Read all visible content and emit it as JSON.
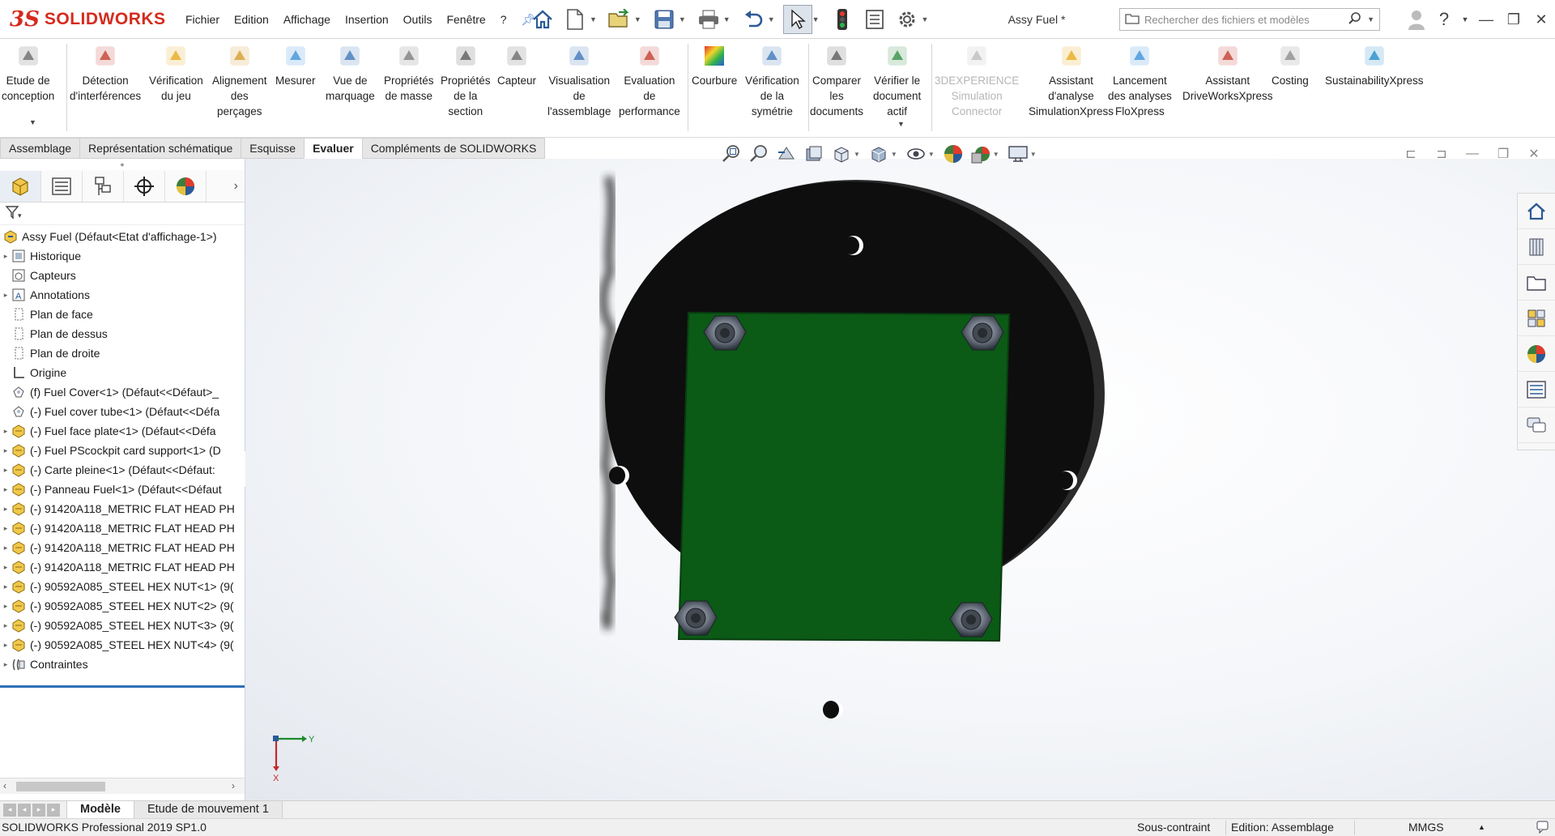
{
  "app": {
    "logo_mark": "3S",
    "logo_text": "SOLIDWORKS",
    "menus": [
      "Fichier",
      "Edition",
      "Affichage",
      "Insertion",
      "Outils",
      "Fenêtre",
      "?"
    ],
    "document_title": "Assy Fuel *",
    "search_placeholder": "Rechercher des fichiers et modèles",
    "help_label": "?"
  },
  "command_manager": {
    "commands": [
      {
        "label": "Etude de\nconception",
        "icon": "design-study-icon"
      },
      {
        "label": "Détection\nd'interférences",
        "icon": "interference-detection-icon"
      },
      {
        "label": "Vérification\ndu jeu",
        "icon": "clearance-verification-icon"
      },
      {
        "label": "Alignement\ndes\nperçages",
        "icon": "hole-alignment-icon"
      },
      {
        "label": "Mesurer",
        "icon": "measure-icon"
      },
      {
        "label": "Vue de\nmarquage",
        "icon": "markup-view-icon"
      },
      {
        "label": "Propriétés\nde masse",
        "icon": "mass-properties-icon"
      },
      {
        "label": "Propriétés\nde la\nsection",
        "icon": "section-properties-icon"
      },
      {
        "label": "Capteur",
        "icon": "sensor-icon"
      },
      {
        "label": "Visualisation\nde\nl'assemblage",
        "icon": "assembly-visualization-icon"
      },
      {
        "label": "Evaluation\nde\nperformance",
        "icon": "performance-evaluation-icon"
      },
      {
        "label": "Courbure",
        "icon": "curvature-icon"
      },
      {
        "label": "Vérification\nde la\nsymétrie",
        "icon": "symmetry-check-icon"
      },
      {
        "label": "Comparer\nles\ndocuments",
        "icon": "compare-documents-icon"
      },
      {
        "label": "Vérifier le\ndocument\nactif",
        "icon": "check-active-document-icon"
      },
      {
        "label": "3DEXPERIENCE\nSimulation\nConnector",
        "icon": "3dexperience-icon",
        "disabled": true
      },
      {
        "label": "Assistant\nd'analyse\nSimulationXpress",
        "icon": "simulationxpress-icon"
      },
      {
        "label": "Lancement\ndes analyses\nFloXpress",
        "icon": "floxpress-icon"
      },
      {
        "label": "Assistant\nDriveWorksXpress",
        "icon": "driveworksxpress-icon"
      },
      {
        "label": "Costing",
        "icon": "costing-icon"
      },
      {
        "label": "SustainabilityXpress",
        "icon": "sustainabilityxpress-icon"
      }
    ],
    "tabs": [
      {
        "label": "Assemblage",
        "active": false
      },
      {
        "label": "Représentation schématique",
        "active": false
      },
      {
        "label": "Esquisse",
        "active": false
      },
      {
        "label": "Evaluer",
        "active": true
      },
      {
        "label": "Compléments de SOLIDWORKS",
        "active": false
      }
    ]
  },
  "feature_tree": {
    "root": "Assy Fuel  (Défaut<Etat d'affichage-1>)",
    "nodes": [
      {
        "label": "Historique",
        "icon": "history-icon",
        "expandable": true
      },
      {
        "label": "Capteurs",
        "icon": "sensors-folder-icon",
        "expandable": false
      },
      {
        "label": "Annotations",
        "icon": "annotations-icon",
        "expandable": true
      },
      {
        "label": "Plan de face",
        "icon": "plane-icon",
        "expandable": false
      },
      {
        "label": "Plan de dessus",
        "icon": "plane-icon",
        "expandable": false
      },
      {
        "label": "Plan de droite",
        "icon": "plane-icon",
        "expandable": false
      },
      {
        "label": "Origine",
        "icon": "origin-icon",
        "expandable": false
      },
      {
        "label": "(f) Fuel Cover<1> (Défaut<<Défaut>_",
        "icon": "part-icon",
        "expandable": false
      },
      {
        "label": "(-) Fuel cover tube<1> (Défaut<<Défa",
        "icon": "part-icon",
        "expandable": false
      },
      {
        "label": "(-) Fuel face plate<1> (Défaut<<Défa",
        "icon": "subassembly-icon",
        "expandable": true
      },
      {
        "label": "(-) Fuel PScockpit card support<1> (D",
        "icon": "subassembly-icon",
        "expandable": true
      },
      {
        "label": "(-) Carte pleine<1> (Défaut<<Défaut:",
        "icon": "subassembly-icon",
        "expandable": true
      },
      {
        "label": "(-) Panneau Fuel<1> (Défaut<<Défaut",
        "icon": "subassembly-icon",
        "expandable": true
      },
      {
        "label": "(-) 91420A118_METRIC FLAT HEAD PH",
        "icon": "subassembly-icon",
        "expandable": true
      },
      {
        "label": "(-) 91420A118_METRIC FLAT HEAD PH",
        "icon": "subassembly-icon",
        "expandable": true
      },
      {
        "label": "(-) 91420A118_METRIC FLAT HEAD PH",
        "icon": "subassembly-icon",
        "expandable": true
      },
      {
        "label": "(-) 91420A118_METRIC FLAT HEAD PH",
        "icon": "subassembly-icon",
        "expandable": true
      },
      {
        "label": "(-) 90592A085_STEEL HEX NUT<1> (9(",
        "icon": "subassembly-icon",
        "expandable": true
      },
      {
        "label": "(-) 90592A085_STEEL HEX NUT<2> (9(",
        "icon": "subassembly-icon",
        "expandable": true
      },
      {
        "label": "(-) 90592A085_STEEL HEX NUT<3> (9(",
        "icon": "subassembly-icon",
        "expandable": true
      },
      {
        "label": "(-) 90592A085_STEEL HEX NUT<4> (9(",
        "icon": "subassembly-icon",
        "expandable": true
      },
      {
        "label": "Contraintes",
        "icon": "mates-icon",
        "expandable": true
      }
    ]
  },
  "viewport": {
    "triad_y": "Y",
    "triad_x": "X"
  },
  "bottom_tabs": [
    {
      "label": "Modèle",
      "active": true
    },
    {
      "label": "Etude de mouvement 1",
      "active": false
    }
  ],
  "status_bar": {
    "product": "SOLIDWORKS Professional 2019 SP1.0",
    "constraint_state": "Sous-contraint",
    "edit_mode": "Edition: Assemblage",
    "units": "MMGS"
  },
  "colors": {
    "brand_red": "#d52b1e",
    "pcb_green": "#0b5a16",
    "disc_black": "#111111",
    "accent_blue": "#2f6fb5"
  }
}
